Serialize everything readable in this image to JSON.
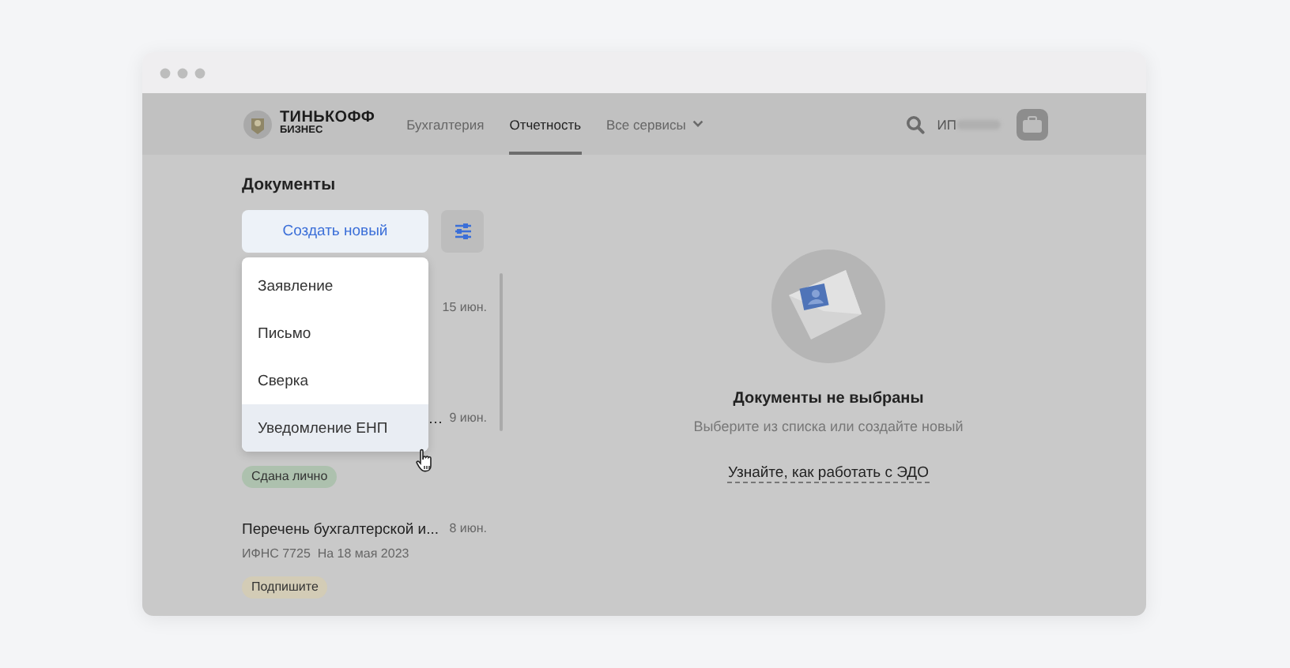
{
  "logo": {
    "line1": "ТИНЬКОФФ",
    "line2": "БИЗНЕС"
  },
  "nav": [
    {
      "label": "Бухгалтерия",
      "selected": false,
      "dropdown": false
    },
    {
      "label": "Отчетность",
      "selected": true,
      "dropdown": false
    },
    {
      "label": "Все сервисы",
      "selected": false,
      "dropdown": true
    }
  ],
  "account": {
    "prefix": "ИП"
  },
  "documents": {
    "title": "Документы",
    "create_button": "Создать новый",
    "menu": [
      {
        "label": "Заявление",
        "highlighted": false
      },
      {
        "label": "Письмо",
        "highlighted": false
      },
      {
        "label": "Сверка",
        "highlighted": false
      },
      {
        "label": "Уведомление ЕНП",
        "highlighted": true
      }
    ],
    "items": [
      {
        "date": "15 июн."
      },
      {
        "title": "…",
        "date": "9 июн.",
        "badge": {
          "text": "Сдана лично",
          "kind": "done"
        }
      },
      {
        "title": "Перечень бухгалтерской и...",
        "date": "8 июн.",
        "subtitle": "ИФНС 7725  На 18 мая 2023",
        "badge": {
          "text": "Подпишите",
          "kind": "sign"
        }
      }
    ]
  },
  "empty_state": {
    "title": "Документы не выбраны",
    "text": "Выберите из списка или создайте новый",
    "link": "Узнайте, как работать с ЭДО"
  }
}
